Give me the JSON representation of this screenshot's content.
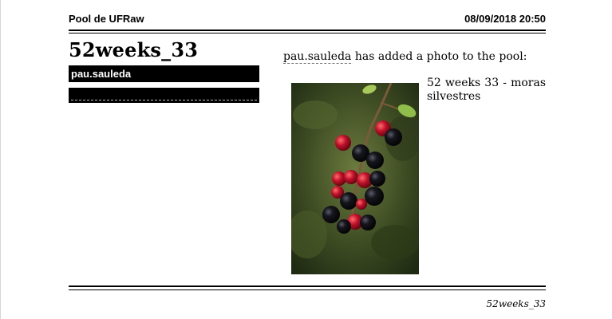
{
  "header": {
    "title": "Pool de UFRaw",
    "datetime": "08/09/2018 20:50"
  },
  "post": {
    "title": "52weeks_33",
    "username": "pau.sauleda",
    "activity_user": "pau.sauleda",
    "activity_text": "has added a photo to the pool:",
    "photo_caption": "52 weeks 33 - moras silvestres"
  },
  "footer": {
    "text": "52weeks_33"
  },
  "colors": {
    "background": "#ffffff",
    "text": "#000000",
    "user_bar": "#000000"
  }
}
